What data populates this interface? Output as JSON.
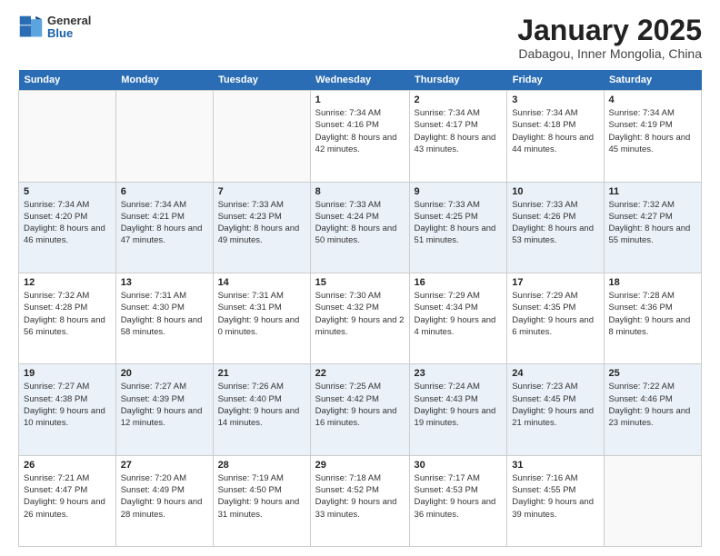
{
  "header": {
    "logo": {
      "general": "General",
      "blue": "Blue"
    },
    "title": "January 2025",
    "location": "Dabagou, Inner Mongolia, China"
  },
  "weekdays": [
    "Sunday",
    "Monday",
    "Tuesday",
    "Wednesday",
    "Thursday",
    "Friday",
    "Saturday"
  ],
  "weeks": [
    [
      {
        "day": "",
        "info": ""
      },
      {
        "day": "",
        "info": ""
      },
      {
        "day": "",
        "info": ""
      },
      {
        "day": "1",
        "info": "Sunrise: 7:34 AM\nSunset: 4:16 PM\nDaylight: 8 hours and 42 minutes."
      },
      {
        "day": "2",
        "info": "Sunrise: 7:34 AM\nSunset: 4:17 PM\nDaylight: 8 hours and 43 minutes."
      },
      {
        "day": "3",
        "info": "Sunrise: 7:34 AM\nSunset: 4:18 PM\nDaylight: 8 hours and 44 minutes."
      },
      {
        "day": "4",
        "info": "Sunrise: 7:34 AM\nSunset: 4:19 PM\nDaylight: 8 hours and 45 minutes."
      }
    ],
    [
      {
        "day": "5",
        "info": "Sunrise: 7:34 AM\nSunset: 4:20 PM\nDaylight: 8 hours and 46 minutes."
      },
      {
        "day": "6",
        "info": "Sunrise: 7:34 AM\nSunset: 4:21 PM\nDaylight: 8 hours and 47 minutes."
      },
      {
        "day": "7",
        "info": "Sunrise: 7:33 AM\nSunset: 4:23 PM\nDaylight: 8 hours and 49 minutes."
      },
      {
        "day": "8",
        "info": "Sunrise: 7:33 AM\nSunset: 4:24 PM\nDaylight: 8 hours and 50 minutes."
      },
      {
        "day": "9",
        "info": "Sunrise: 7:33 AM\nSunset: 4:25 PM\nDaylight: 8 hours and 51 minutes."
      },
      {
        "day": "10",
        "info": "Sunrise: 7:33 AM\nSunset: 4:26 PM\nDaylight: 8 hours and 53 minutes."
      },
      {
        "day": "11",
        "info": "Sunrise: 7:32 AM\nSunset: 4:27 PM\nDaylight: 8 hours and 55 minutes."
      }
    ],
    [
      {
        "day": "12",
        "info": "Sunrise: 7:32 AM\nSunset: 4:28 PM\nDaylight: 8 hours and 56 minutes."
      },
      {
        "day": "13",
        "info": "Sunrise: 7:31 AM\nSunset: 4:30 PM\nDaylight: 8 hours and 58 minutes."
      },
      {
        "day": "14",
        "info": "Sunrise: 7:31 AM\nSunset: 4:31 PM\nDaylight: 9 hours and 0 minutes."
      },
      {
        "day": "15",
        "info": "Sunrise: 7:30 AM\nSunset: 4:32 PM\nDaylight: 9 hours and 2 minutes."
      },
      {
        "day": "16",
        "info": "Sunrise: 7:29 AM\nSunset: 4:34 PM\nDaylight: 9 hours and 4 minutes."
      },
      {
        "day": "17",
        "info": "Sunrise: 7:29 AM\nSunset: 4:35 PM\nDaylight: 9 hours and 6 minutes."
      },
      {
        "day": "18",
        "info": "Sunrise: 7:28 AM\nSunset: 4:36 PM\nDaylight: 9 hours and 8 minutes."
      }
    ],
    [
      {
        "day": "19",
        "info": "Sunrise: 7:27 AM\nSunset: 4:38 PM\nDaylight: 9 hours and 10 minutes."
      },
      {
        "day": "20",
        "info": "Sunrise: 7:27 AM\nSunset: 4:39 PM\nDaylight: 9 hours and 12 minutes."
      },
      {
        "day": "21",
        "info": "Sunrise: 7:26 AM\nSunset: 4:40 PM\nDaylight: 9 hours and 14 minutes."
      },
      {
        "day": "22",
        "info": "Sunrise: 7:25 AM\nSunset: 4:42 PM\nDaylight: 9 hours and 16 minutes."
      },
      {
        "day": "23",
        "info": "Sunrise: 7:24 AM\nSunset: 4:43 PM\nDaylight: 9 hours and 19 minutes."
      },
      {
        "day": "24",
        "info": "Sunrise: 7:23 AM\nSunset: 4:45 PM\nDaylight: 9 hours and 21 minutes."
      },
      {
        "day": "25",
        "info": "Sunrise: 7:22 AM\nSunset: 4:46 PM\nDaylight: 9 hours and 23 minutes."
      }
    ],
    [
      {
        "day": "26",
        "info": "Sunrise: 7:21 AM\nSunset: 4:47 PM\nDaylight: 9 hours and 26 minutes."
      },
      {
        "day": "27",
        "info": "Sunrise: 7:20 AM\nSunset: 4:49 PM\nDaylight: 9 hours and 28 minutes."
      },
      {
        "day": "28",
        "info": "Sunrise: 7:19 AM\nSunset: 4:50 PM\nDaylight: 9 hours and 31 minutes."
      },
      {
        "day": "29",
        "info": "Sunrise: 7:18 AM\nSunset: 4:52 PM\nDaylight: 9 hours and 33 minutes."
      },
      {
        "day": "30",
        "info": "Sunrise: 7:17 AM\nSunset: 4:53 PM\nDaylight: 9 hours and 36 minutes."
      },
      {
        "day": "31",
        "info": "Sunrise: 7:16 AM\nSunset: 4:55 PM\nDaylight: 9 hours and 39 minutes."
      },
      {
        "day": "",
        "info": ""
      }
    ]
  ]
}
